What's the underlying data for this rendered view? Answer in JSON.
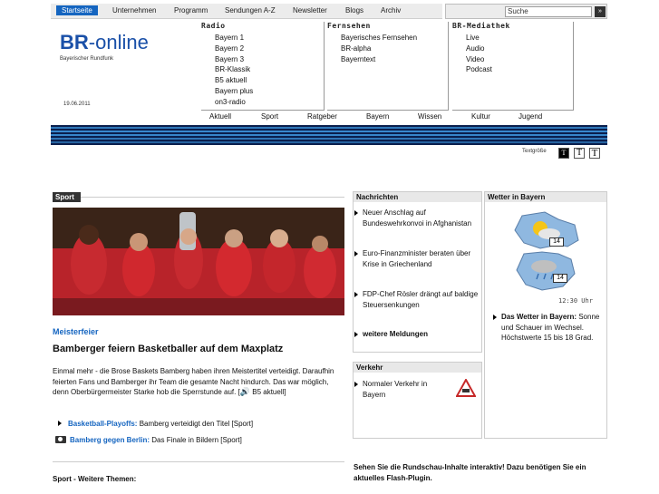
{
  "topnav": {
    "items": [
      "Startseite",
      "Unternehmen",
      "Programm",
      "Sendungen A-Z",
      "Newsletter",
      "Blogs",
      "Archiv"
    ],
    "active": "Startseite"
  },
  "search": {
    "value": "Suche",
    "go": "»"
  },
  "logo": {
    "br": "BR",
    "rest": "-online",
    "sub": "Bayerischer Rundfunk"
  },
  "date": "19.06.2011",
  "radio": {
    "head": "Radio",
    "links": [
      "Bayern 1",
      "Bayern 2",
      "Bayern 3",
      "BR-Klassik",
      "B5 aktuell",
      "Bayern plus",
      "on3-radio"
    ]
  },
  "fernsehen": {
    "head": "Fernsehen",
    "links": [
      "Bayerisches Fernsehen",
      "BR-alpha",
      "Bayerntext"
    ]
  },
  "mediathek": {
    "head": "BR-Mediathek",
    "links": [
      "Live",
      "Audio",
      "Video",
      "Podcast"
    ]
  },
  "subnav": [
    "Aktuell",
    "Sport",
    "Ratgeber",
    "Bayern",
    "Wissen",
    "Kultur",
    "Jugend"
  ],
  "textsize": {
    "label": "Textgröße",
    "buttons": [
      "T",
      "T",
      "T"
    ]
  },
  "main": {
    "section": "Sport",
    "kicker": "Meisterfeier",
    "headline": "Bamberger feiern Basketballer auf dem Maxplatz",
    "body": "Einmal mehr - die Brose Baskets Bamberg haben ihren Meistertitel verteidigt. Daraufhin feierten Fans und Bamberger ihr Team die gesamte Nacht hindurch. Das war möglich, denn Oberbürgermeister Starke hob die Sperrstunde auf. [",
    "body_audio": "B5 aktuell]",
    "links": [
      {
        "bold": "Basketball-Playoffs:",
        "rest": " Bamberg verteidigt den Titel [Sport]"
      },
      {
        "bold": "Bamberg gegen Berlin:",
        "rest": " Das Finale in Bildern [Sport]"
      }
    ],
    "more_themes": "Sport - Weitere Themen:"
  },
  "nachrichten": {
    "head": "Nachrichten",
    "items": [
      "Neuer Anschlag auf Bundeswehrkonvoi in Afghanistan",
      "Euro-Finanzminister beraten über Krise in Griechenland",
      "FDP-Chef Rösler drängt auf baldige Steuersenkungen"
    ],
    "more": "weitere Meldungen"
  },
  "verkehr": {
    "head": "Verkehr",
    "item": "Normaler Verkehr in Bayern"
  },
  "wetter": {
    "head": "Wetter in Bayern",
    "temps": [
      "14",
      "14"
    ],
    "time": "12:30 Uhr",
    "link": "Das Wetter in Bayern:",
    "text": " Sonne und Schauer im Wechsel. Höchstwerte 15 bis 18 Grad."
  },
  "flash": "Sehen Sie die Rundschau-Inhalte interaktiv! Dazu benötigen Sie ein aktuelles Flash-Plugin.",
  "colors": {
    "accent": "#1565c0",
    "dark": "#333333",
    "stripe_dark": "#0a1f4d",
    "stripe_light": "#3a8fd6",
    "hero_red": "#c01f28"
  }
}
